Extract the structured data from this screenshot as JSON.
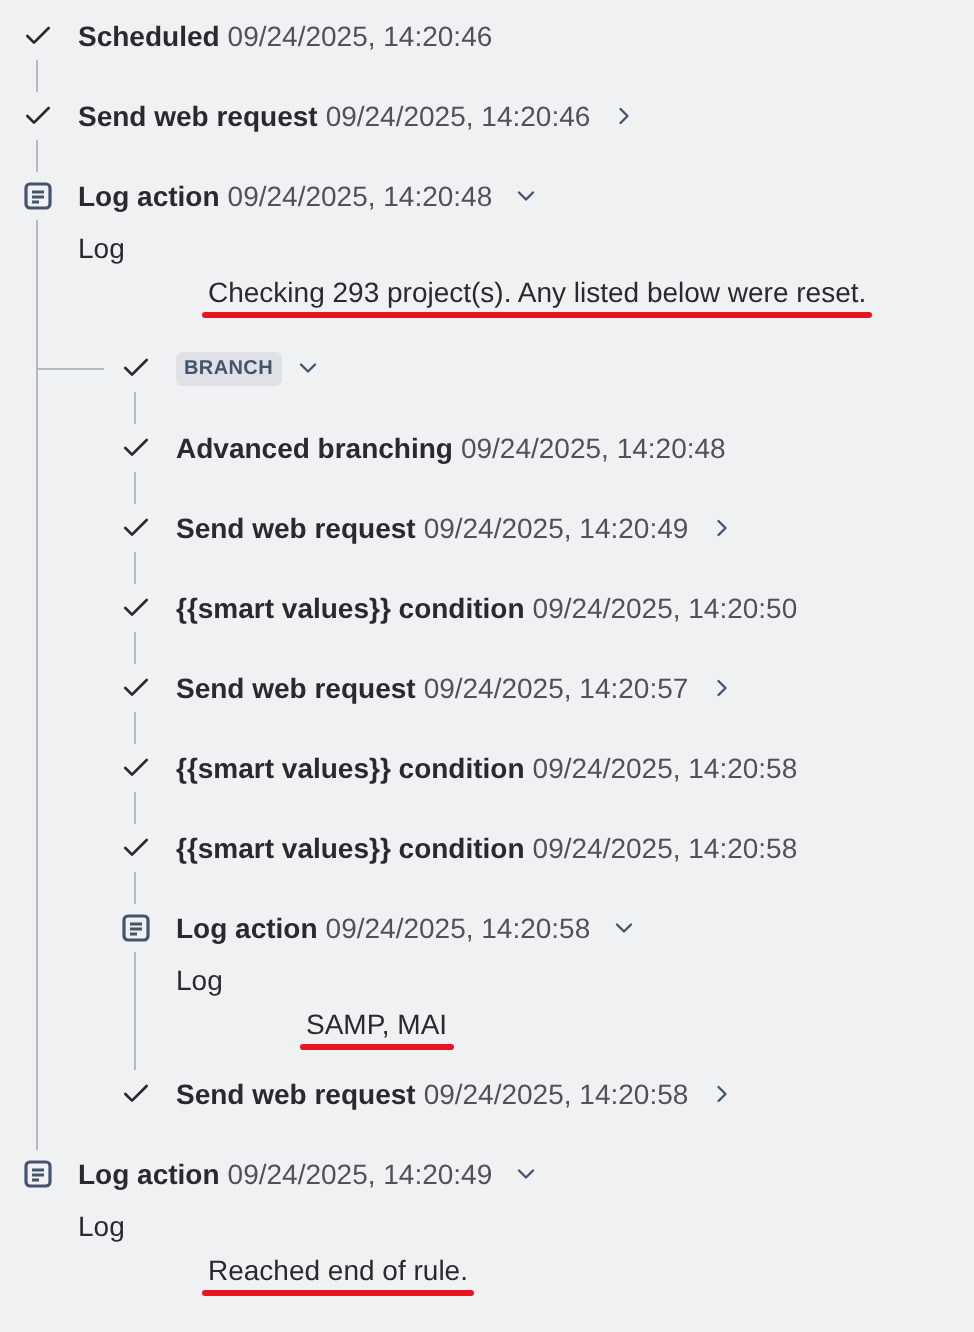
{
  "steps": [
    {
      "kind": "success",
      "title": "Scheduled",
      "time": "09/24/2025, 14:20:46"
    },
    {
      "kind": "success",
      "title": "Send web request",
      "time": "09/24/2025, 14:20:46",
      "expanded": false
    },
    {
      "kind": "log",
      "title": "Log action",
      "time": "09/24/2025, 14:20:48",
      "expanded": true,
      "log": {
        "label": "Log",
        "message": "Checking 293 project(s). Any listed below were reset.",
        "underlined": true
      },
      "children": [
        {
          "kind": "branch",
          "badge": "BRANCH",
          "expanded": true,
          "children": [
            {
              "kind": "success",
              "title": "Advanced branching",
              "time": "09/24/2025, 14:20:48"
            },
            {
              "kind": "success",
              "title": "Send web request",
              "time": "09/24/2025, 14:20:49",
              "expanded": false
            },
            {
              "kind": "success",
              "title": "{{smart values}} condition",
              "time": "09/24/2025, 14:20:50"
            },
            {
              "kind": "success",
              "title": "Send web request",
              "time": "09/24/2025, 14:20:57",
              "expanded": false
            },
            {
              "kind": "success",
              "title": "{{smart values}} condition",
              "time": "09/24/2025, 14:20:58"
            },
            {
              "kind": "success",
              "title": "{{smart values}} condition",
              "time": "09/24/2025, 14:20:58"
            },
            {
              "kind": "log",
              "title": "Log action",
              "time": "09/24/2025, 14:20:58",
              "expanded": true,
              "log": {
                "label": "Log",
                "message": "SAMP, MAI",
                "underlined": true
              }
            },
            {
              "kind": "success",
              "title": "Send web request",
              "time": "09/24/2025, 14:20:58",
              "expanded": false
            }
          ]
        }
      ]
    },
    {
      "kind": "log",
      "title": "Log action",
      "time": "09/24/2025, 14:20:49",
      "expanded": true,
      "log": {
        "label": "Log",
        "message": "Reached end of rule.",
        "underlined": true
      }
    }
  ]
}
